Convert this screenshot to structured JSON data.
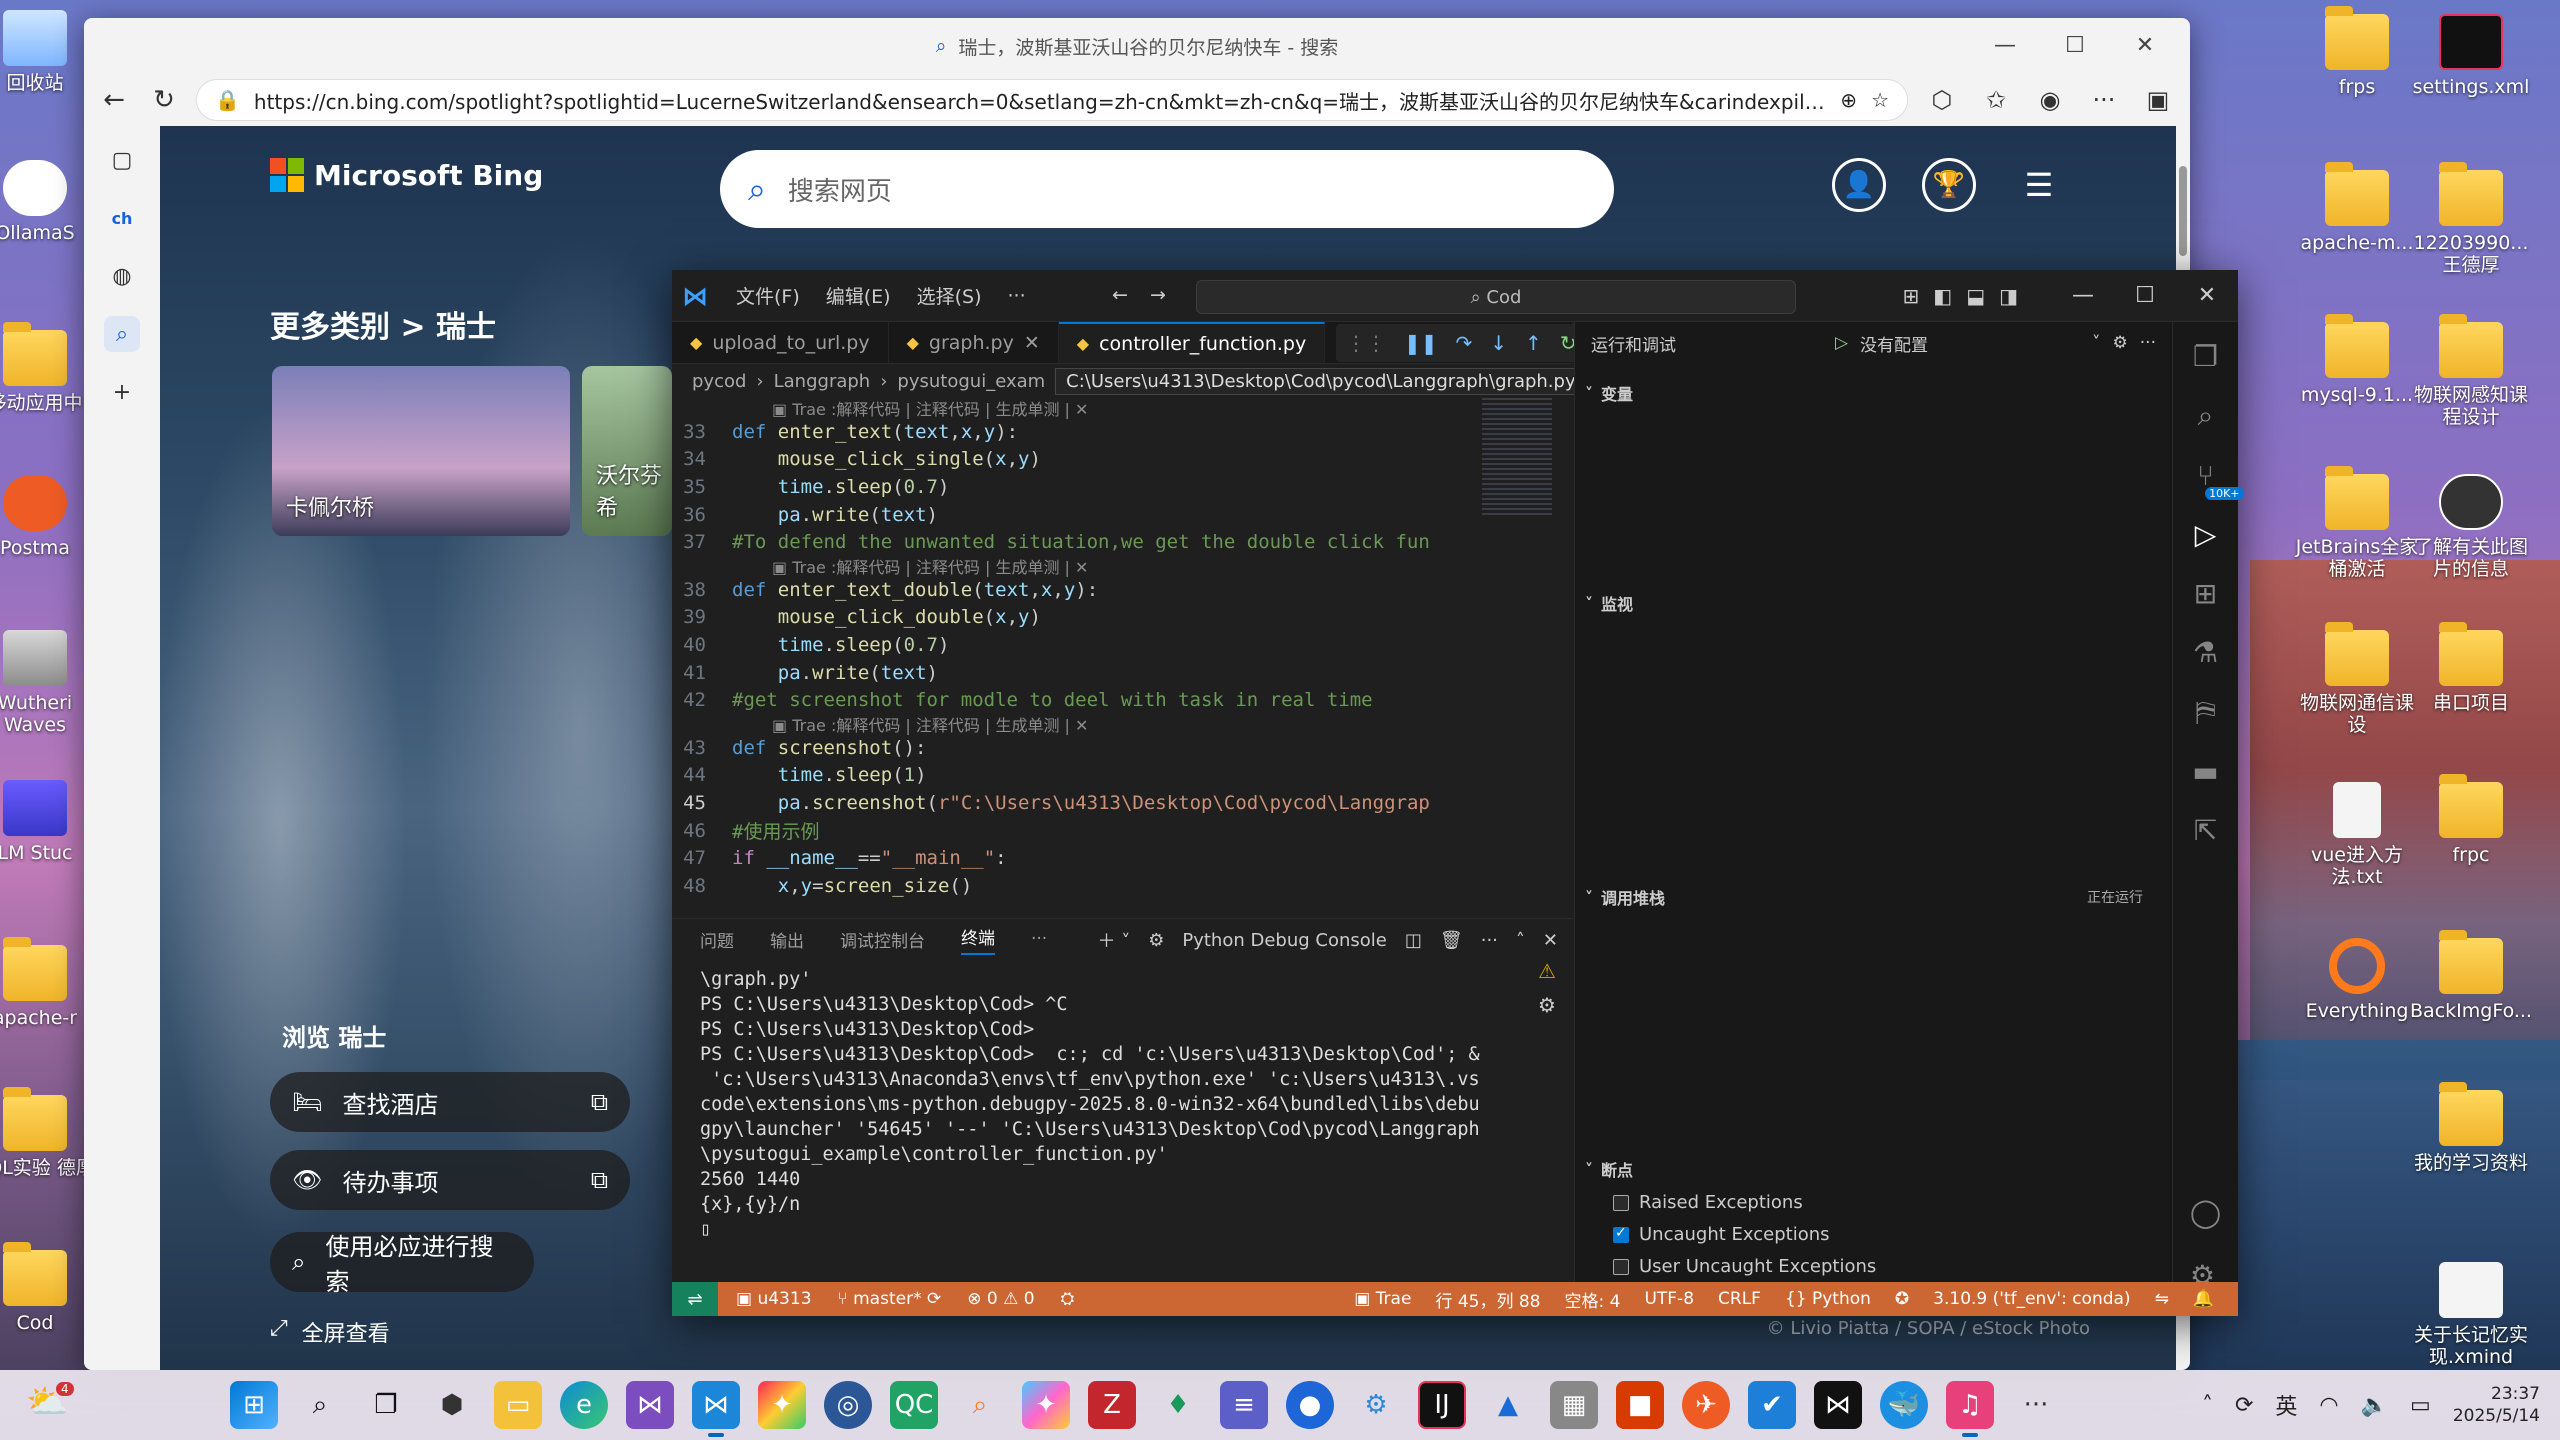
{
  "desktop": {
    "left_icons": [
      "回收站",
      "OllamaS",
      "移动应用中",
      "Postma",
      "Wutheri Waves",
      "LM Stuc",
      "apache-r",
      "SQL实验 德厚",
      "Cod"
    ],
    "right_icons": [
      "frps",
      "settings.xml",
      "apache-m...",
      "12203990... 王德厚",
      "mysql-9.1...",
      "物联网感知课程设计",
      "JetBrains全家桶激活",
      "了解有关此图片的信息",
      "物联网通信课设",
      "串口项目",
      "vue进入方法.txt",
      "frpc",
      "Everything",
      "BackImgFo...",
      "我的学习资料",
      "关于长记忆实现.xmind"
    ]
  },
  "browser": {
    "title": "瑞士，波斯基亚沃山谷的贝尔尼纳快车 - 搜索",
    "url": "https://cn.bing.com/spotlight?spotlightid=LucerneSwitzerland&ensearch=0&setlang=zh-cn&mkt=zh-cn&q=瑞士，波斯基亚沃山谷的贝尔尼纳快车&carindexpill=0...",
    "win_min": "—",
    "win_max": "☐",
    "win_close": "✕"
  },
  "bing": {
    "logo_text": "Microsoft Bing",
    "search_placeholder": "搜索网页",
    "crumb": "更多类别 > 瑞士",
    "thumbs": [
      "卡佩尔桥",
      "沃尔芬希"
    ],
    "browse_title": "浏览 瑞士",
    "actions": [
      "查找酒店",
      "待办事项",
      "使用必应进行搜索"
    ],
    "fullview": "全屏查看",
    "credit": "© Livio Piatta / SOPA / eStock Photo"
  },
  "vscode": {
    "menus": [
      "文件(F)",
      "编辑(E)",
      "选择(S)",
      "···"
    ],
    "command_center": "Cod",
    "tabs": [
      {
        "label": "upload_to_url.py",
        "active": false
      },
      {
        "label": "graph.py",
        "active": false
      },
      {
        "label": "controller_function.py",
        "active": true
      }
    ],
    "breadcrumb": [
      "pycod",
      "Langgraph",
      "pysutogui_exam"
    ],
    "path_tooltip": "C:\\Users\\u4313\\Desktop\\Cod\\pycod\\Langgraph\\graph.py",
    "codelens": "Trae :解释代码 | 注释代码 | 生成单测 | ✕",
    "code": [
      {
        "ln": "33",
        "lens": true,
        "html": "<span class='kw'>def</span> <span class='fn'>enter_text</span>(<span class='var'>text</span>,<span class='var'>x</span>,<span class='var'>y</span>):"
      },
      {
        "ln": "34",
        "html": "    <span class='fn'>mouse_click_single</span>(<span class='var'>x</span>,<span class='var'>y</span>)"
      },
      {
        "ln": "35",
        "html": "    <span class='var'>time</span>.<span class='fn'>sleep</span>(<span class='num'>0.7</span>)"
      },
      {
        "ln": "36",
        "html": "    <span class='var'>pa</span>.<span class='fn'>write</span>(<span class='var'>text</span>)"
      },
      {
        "ln": "37",
        "html": "<span class='cm'>#To defend the unwanted situation,we get the double click fun</span>"
      },
      {
        "ln": "38",
        "lens": true,
        "html": "<span class='kw'>def</span> <span class='fn'>enter_text_double</span>(<span class='var'>text</span>,<span class='var'>x</span>,<span class='var'>y</span>):"
      },
      {
        "ln": "39",
        "html": "    <span class='fn'>mouse_click_double</span>(<span class='var'>x</span>,<span class='var'>y</span>)"
      },
      {
        "ln": "40",
        "html": "    <span class='var'>time</span>.<span class='fn'>sleep</span>(<span class='num'>0.7</span>)"
      },
      {
        "ln": "41",
        "html": "    <span class='var'>pa</span>.<span class='fn'>write</span>(<span class='var'>text</span>)"
      },
      {
        "ln": "42",
        "html": "<span class='cm'>#get screenshot for modle to deel with task in real time</span>"
      },
      {
        "ln": "43",
        "lens": true,
        "html": "<span class='kw'>def</span> <span class='fn'>screenshot</span>():"
      },
      {
        "ln": "44",
        "html": "    <span class='var'>time</span>.<span class='fn'>sleep</span>(<span class='num'>1</span>)"
      },
      {
        "ln": "45",
        "cur": true,
        "html": "    <span class='var'>pa</span>.<span class='fn'>screenshot</span>(<span class='str'>r\"C:\\Users\\u4313\\Desktop\\Cod\\pycod\\Langgrap</span>"
      },
      {
        "ln": "46",
        "html": "<span class='cm'>#使用示例</span>"
      },
      {
        "ln": "47",
        "html": "<span class='ctl'>if</span> <span class='var'>__name__</span>==<span class='str'>\"__main__\"</span>:"
      },
      {
        "ln": "48",
        "html": "    <span class='var'>x</span>,<span class='var'>y</span>=<span class='fn'>screen_size</span>()"
      }
    ],
    "debug_panel": {
      "title": "运行和调试",
      "config": "没有配置",
      "sections": [
        "变量",
        "监视",
        "调用堆栈",
        "断点"
      ],
      "callstack_status": "正在运行",
      "breakpoints": [
        {
          "label": "Raised Exceptions",
          "checked": false
        },
        {
          "label": "Uncaught Exceptions",
          "checked": true
        },
        {
          "label": "User Uncaught Exceptions",
          "checked": false
        }
      ]
    },
    "panel_tabs": [
      "问题",
      "输出",
      "调试控制台",
      "终端",
      "···"
    ],
    "terminal_name": "Python Debug Console",
    "terminal_lines": [
      "\\graph.py'",
      "PS C:\\Users\\u4313\\Desktop\\Cod> ^C",
      "PS C:\\Users\\u4313\\Desktop\\Cod>",
      "PS C:\\Users\\u4313\\Desktop\\Cod>  c:; cd 'c:\\Users\\u4313\\Desktop\\Cod'; &",
      " 'c:\\Users\\u4313\\Anaconda3\\envs\\tf_env\\python.exe' 'c:\\Users\\u4313\\.vs",
      "code\\extensions\\ms-python.debugpy-2025.8.0-win32-x64\\bundled\\libs\\debu",
      "gpy\\launcher' '54645' '--' 'C:\\Users\\u4313\\Desktop\\Cod\\pycod\\Langgraph",
      "\\pysutogui_example\\controller_function.py'",
      "2560 1440",
      "{x},{y}/n",
      "▯"
    ],
    "status": {
      "user": "u4313",
      "branch": "master*",
      "errors": "⊗ 0 ⚠ 0",
      "trae": "Trae",
      "position": "行 45，列 88",
      "spaces": "空格: 4",
      "encoding": "UTF-8",
      "eol": "CRLF",
      "lang": "{} Python",
      "interpreter": "3.10.9 ('tf_env': conda)",
      "badge_10k": "10K+"
    }
  },
  "taskbar": {
    "weather_badge": "4",
    "ime": "英",
    "time": "23:37",
    "date": "2025/5/14"
  }
}
